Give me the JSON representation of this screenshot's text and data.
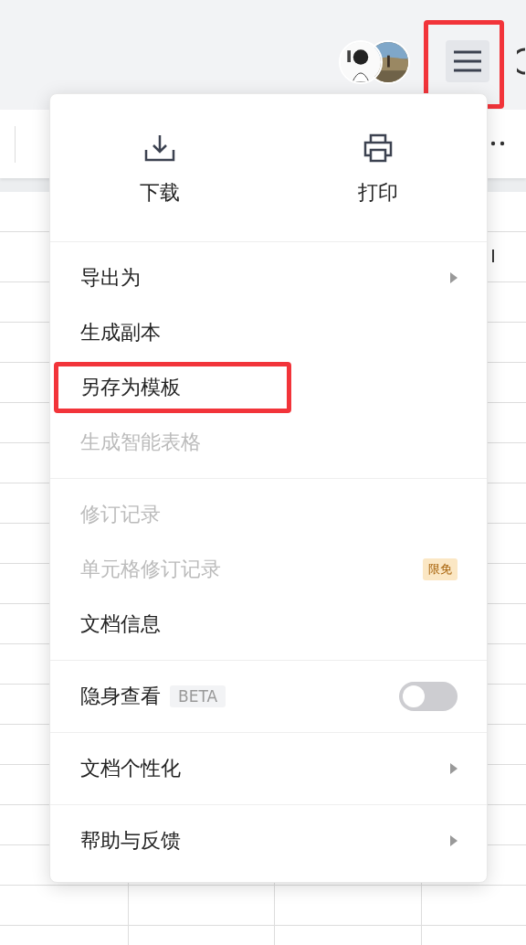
{
  "top_bar": {
    "menu_button": {
      "highlighted": true
    }
  },
  "sheet": {
    "column_header": "I"
  },
  "menu": {
    "actions": [
      {
        "label": "下载",
        "kind": "download"
      },
      {
        "label": "打印",
        "kind": "print"
      }
    ],
    "sections": [
      [
        {
          "label": "导出为",
          "disabled": false,
          "submenu": true,
          "highlighted": false
        },
        {
          "label": "生成副本",
          "disabled": false,
          "submenu": false,
          "highlighted": false
        },
        {
          "label": "另存为模板",
          "disabled": false,
          "submenu": false,
          "highlighted": true
        },
        {
          "label": "生成智能表格",
          "disabled": true,
          "submenu": false,
          "highlighted": false
        }
      ],
      [
        {
          "label": "修订记录",
          "disabled": true,
          "submenu": false,
          "highlighted": false
        },
        {
          "label": "单元格修订记录",
          "disabled": true,
          "submenu": false,
          "highlighted": false,
          "badge": "限免"
        },
        {
          "label": "文档信息",
          "disabled": false,
          "submenu": false,
          "highlighted": false
        }
      ],
      [
        {
          "label": "隐身查看",
          "disabled": false,
          "submenu": false,
          "highlighted": false,
          "tag": "BETA",
          "toggle": {
            "on": false
          }
        }
      ],
      [
        {
          "label": "文档个性化",
          "disabled": false,
          "submenu": true,
          "highlighted": false
        }
      ],
      [
        {
          "label": "帮助与反馈",
          "disabled": false,
          "submenu": true,
          "highlighted": false
        }
      ]
    ]
  }
}
